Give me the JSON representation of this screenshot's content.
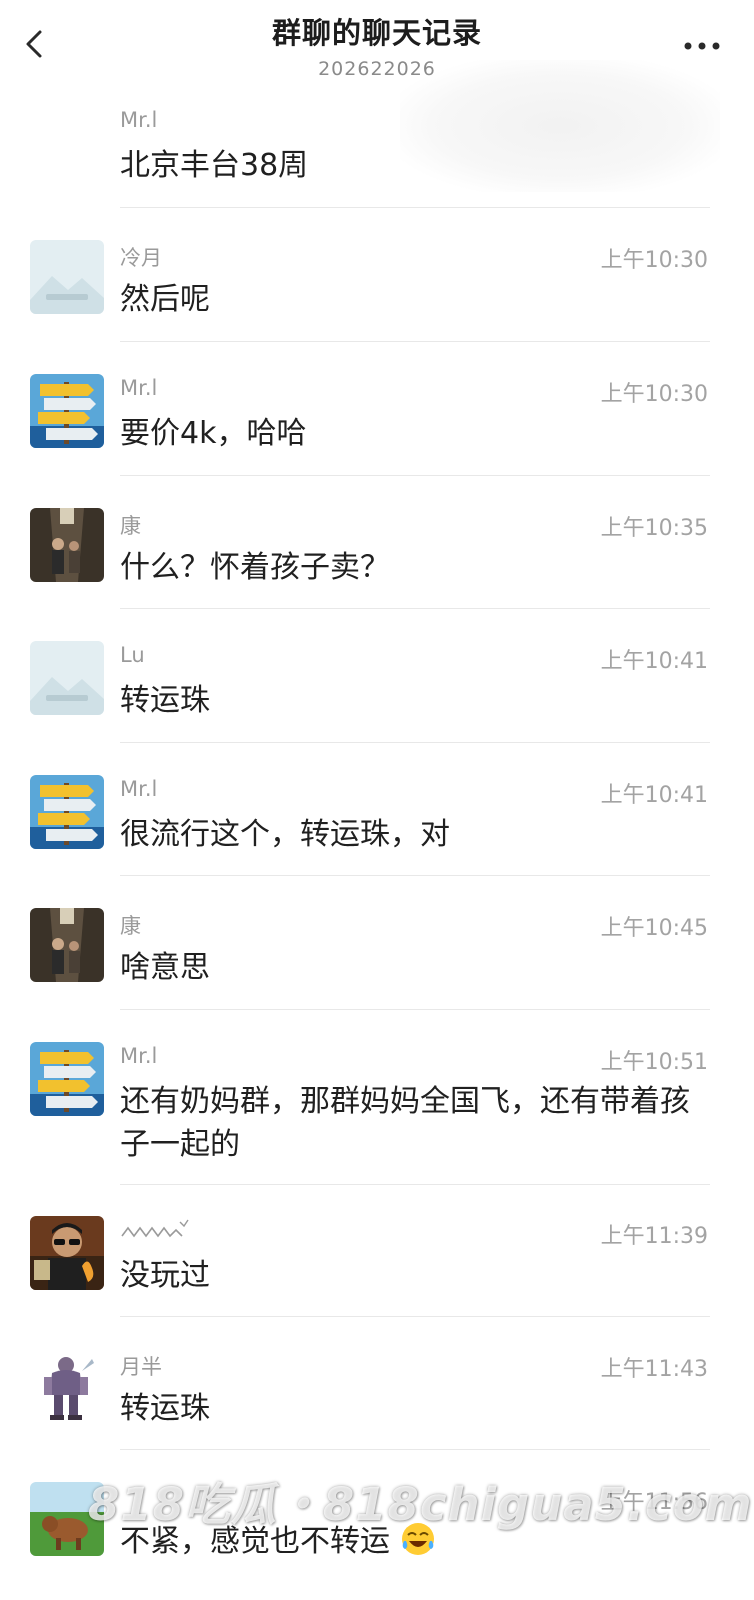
{
  "header": {
    "title": "群聊的聊天记录",
    "subtitle": "202622026"
  },
  "messages": [
    {
      "sender": "Mr.l",
      "time": "",
      "text": "北京丰台38周",
      "avatar": "none"
    },
    {
      "sender": "冷月",
      "time": "上午10:30",
      "text": "然后呢",
      "avatar": "placeholder-image-icon"
    },
    {
      "sender": "Mr.l",
      "time": "上午10:30",
      "text": "要价4k，哈哈",
      "avatar": "signpost-avatar"
    },
    {
      "sender": "康",
      "time": "上午10:35",
      "text": "什么？怀着孩子卖？",
      "avatar": "hallway-photo-avatar"
    },
    {
      "sender": "Lu",
      "time": "上午10:41",
      "text": "转运珠",
      "avatar": "placeholder-image-icon"
    },
    {
      "sender": "Mr.l",
      "time": "上午10:41",
      "text": "很流行这个，转运珠，对",
      "avatar": "signpost-avatar"
    },
    {
      "sender": "康",
      "time": "上午10:45",
      "text": "啥意思",
      "avatar": "hallway-photo-avatar"
    },
    {
      "sender": "Mr.l",
      "time": "上午10:51",
      "text": "还有奶妈群，那群妈妈全国飞，还有带着孩子一起的",
      "avatar": "signpost-avatar"
    },
    {
      "sender": "",
      "time": "上午11:39",
      "text": "没玩过",
      "avatar": "sunglasses-man-avatar"
    },
    {
      "sender": "月半",
      "time": "上午11:43",
      "text": "转运珠",
      "avatar": "armored-character-avatar"
    },
    {
      "sender": "",
      "time": "上午11:56",
      "text": "不紧，感觉也不转运",
      "avatar": "grassland-cow-avatar"
    }
  ],
  "watermark": "818吃瓜・818chigua5.com",
  "icons": {
    "back": "chevron-left-icon",
    "more": "more-dots-icon",
    "emoji": "laughing-crying-emoji-icon",
    "scribble_name": "scribble-name-icon"
  },
  "colors": {
    "background": "#ffffff",
    "text": "#202020",
    "meta": "#a3a3a3",
    "divider": "#e8e8e8"
  }
}
